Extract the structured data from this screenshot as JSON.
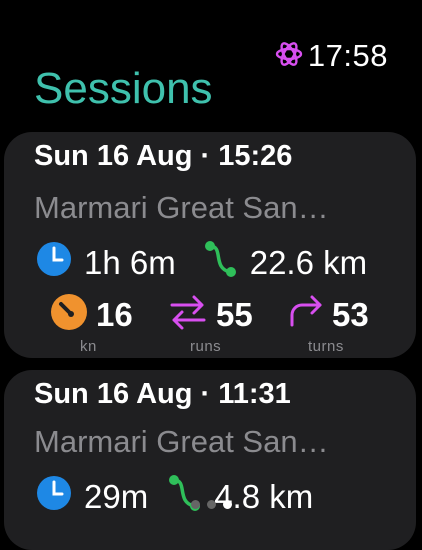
{
  "status": {
    "time": "17:58",
    "icon": "atom-icon"
  },
  "page": {
    "title": "Sessions"
  },
  "sessions": [
    {
      "date": "Sun 16 Aug · 15:26",
      "location": "Marmari Great San…",
      "duration": "1h 6m",
      "distance": "22.6 km",
      "max_speed": "16",
      "max_speed_unit": "kn",
      "runs": "55",
      "runs_unit": "runs",
      "turns": "53",
      "turns_unit": "turns"
    },
    {
      "date": "Sun 16 Aug · 11:31",
      "location": "Marmari Great San…",
      "duration": "29m",
      "distance": "4.8 km"
    }
  ],
  "pager": {
    "count": 3,
    "active_index": 2
  },
  "colors": {
    "accent": "#3fc1ad",
    "clock": "#1e88e5",
    "route": "#2fbf5a",
    "speed": "#f0922e",
    "runs": "#d84ff0"
  }
}
